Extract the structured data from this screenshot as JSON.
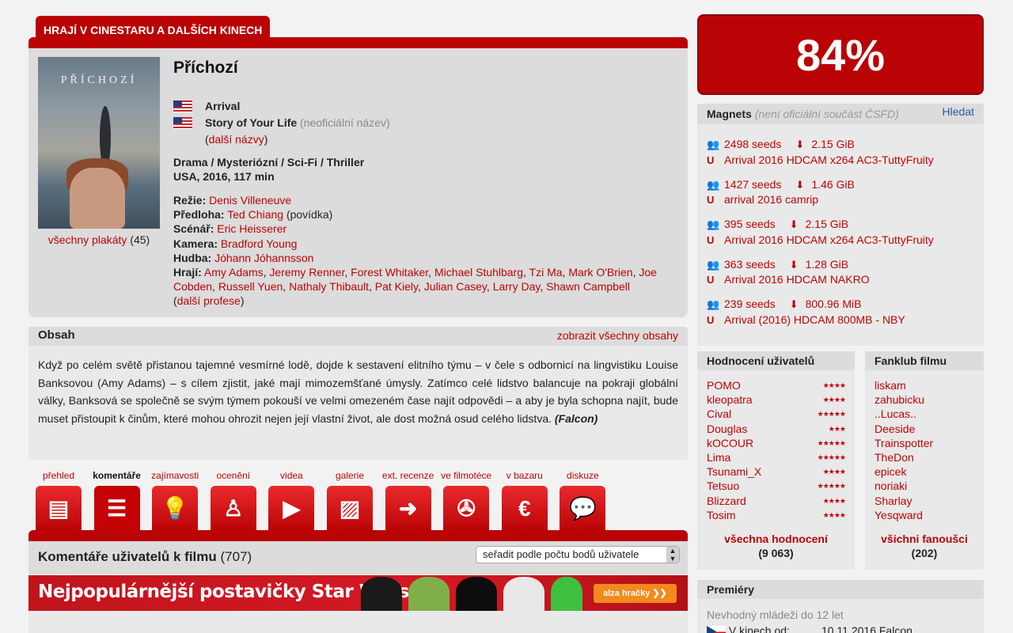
{
  "header_tab": "HRAJÍ V CINESTARU A DALŠÍCH KINECH",
  "film": {
    "poster_title": "PŘÍCHOZÍ",
    "all_posters_link": "všechny plakáty",
    "all_posters_count": "(45)",
    "title": "Příchozí",
    "names": [
      {
        "name": "Arrival",
        "note": ""
      },
      {
        "name": "Story of Your Life",
        "note": "(neoficiální název)"
      }
    ],
    "other_names_pre": "(",
    "other_names_link": "další názvy",
    "other_names_post": ")",
    "genre": "Drama / Mysteriózní / Sci-Fi / Thriller",
    "origin": "USA, 2016, 117 min",
    "creators": {
      "directing_label": "Režie:",
      "directing": "Denis Villeneuve",
      "source_label": "Předloha:",
      "source": "Ted Chiang",
      "source_note": "(povídka)",
      "script_label": "Scénář:",
      "script": "Eric Heisserer",
      "camera_label": "Kamera:",
      "camera": "Bradford Young",
      "music_label": "Hudba:",
      "music": "Jóhann Jóhannsson",
      "cast_label": "Hrají:",
      "cast": [
        "Amy Adams",
        "Jeremy Renner",
        "Forest Whitaker",
        "Michael Stuhlbarg",
        "Tzi Ma",
        "Mark O'Brien",
        "Joe Cobden",
        "Russell Yuen",
        "Nathaly Thibault",
        "Pat Kiely",
        "Julian Casey",
        "Larry Day",
        "Shawn Campbell"
      ],
      "more_professions": "další profese"
    }
  },
  "plot": {
    "heading": "Obsah",
    "show_all": "zobrazit všechny obsahy",
    "text": "Když po celém světě přistanou tajemné vesmírné lodě, dojde k sestavení elitního týmu – v čele s odbornicí na lingvistiku Louise Banksovou (Amy Adams) – s cílem zjistit, jaké mají mimozemšťané úmysly. Zatímco celé lidstvo balancuje na pokraji globální války, Banksová se společně se svým týmem pokouší ve velmi omezeném čase najít odpovědi – a aby je byla schopna najít, bude muset přistoupit k činům, které mohou ohrozit nejen její vlastní život, ale dost možná osud celého lidstva.",
    "author": "(Falcon)"
  },
  "tabs": [
    {
      "label": "přehled",
      "icon": "overview-icon",
      "glyph": "▤"
    },
    {
      "label": "komentáře",
      "icon": "comments-icon",
      "glyph": "☰"
    },
    {
      "label": "zajímavosti",
      "icon": "lightbulb-icon",
      "glyph": "💡"
    },
    {
      "label": "ocenění",
      "icon": "oscar-icon",
      "glyph": "♙"
    },
    {
      "label": "videa",
      "icon": "video-icon",
      "glyph": "▶"
    },
    {
      "label": "galerie",
      "icon": "gallery-icon",
      "glyph": "▨"
    },
    {
      "label": "ext. recenze",
      "icon": "external-review-icon",
      "glyph": "➜"
    },
    {
      "label": "ve filmotéce",
      "icon": "film-reel-icon",
      "glyph": "✇"
    },
    {
      "label": "v bazaru",
      "icon": "euro-icon",
      "glyph": "€"
    },
    {
      "label": "diskuze",
      "icon": "discussion-icon",
      "glyph": "💬"
    }
  ],
  "comments": {
    "heading": "Komentáře uživatelů k filmu",
    "count": "(707)",
    "sort_value": "seřadit podle počtu bodů uživatele"
  },
  "banner": {
    "text": "Nejpopulárnější postavičky Star Wars",
    "button": "alza hračky  ❯❯"
  },
  "rating": "84%",
  "magnets": {
    "heading": "Magnets",
    "note": "(není oficiální součást ČSFD)",
    "search": "Hledat",
    "items": [
      {
        "seeds": "2498 seeds",
        "size": "2.15 GiB",
        "name": "Arrival 2016 HDCAM x264 AC3-TuttyFruity"
      },
      {
        "seeds": "1427 seeds",
        "size": "1.46 GiB",
        "name": "arrival 2016 camrip"
      },
      {
        "seeds": "395 seeds",
        "size": "2.15 GiB",
        "name": "Arrival 2016 HDCAM x264 AC3-TuttyFruity"
      },
      {
        "seeds": "363 seeds",
        "size": "1.28 GiB",
        "name": "Arrival 2016 HDCAM NAKRO"
      },
      {
        "seeds": "239 seeds",
        "size": "800.96 MiB",
        "name": "Arrival (2016) HDCAM 800MB - NBY"
      }
    ]
  },
  "user_ratings": {
    "heading": "Hodnocení uživatelů",
    "items": [
      {
        "user": "POMO",
        "stars": 4
      },
      {
        "user": "kleopatra",
        "stars": 4
      },
      {
        "user": "Cival",
        "stars": 5
      },
      {
        "user": "Douglas",
        "stars": 3
      },
      {
        "user": "kOCOUR",
        "stars": 5
      },
      {
        "user": "Lima",
        "stars": 5
      },
      {
        "user": "Tsunami_X",
        "stars": 4
      },
      {
        "user": "Tetsuo",
        "stars": 5
      },
      {
        "user": "Blizzard",
        "stars": 4
      },
      {
        "user": "Tosim",
        "stars": 4
      }
    ],
    "all_link": "všechna hodnocení",
    "all_count": "(9 063)"
  },
  "fanclub": {
    "heading": "Fanklub filmu",
    "items": [
      "liskam",
      "zahubicku",
      "..Lucas..",
      "Deeside",
      "Trainspotter",
      "TheDon",
      "epicek",
      "noriaki",
      "Sharlay",
      "Yesqward"
    ],
    "all_link": "všichni fanoušci",
    "all_count": "(202)"
  },
  "premieres": {
    "heading": "Premiéry",
    "age_note": "Nevhodný mládeži do 12 let",
    "cinema_label": "V kinech od:",
    "cinema_date": "10.11.2016 Falcon"
  },
  "colors": {
    "accent": "#ba0305",
    "panel": "#dcdcdc",
    "panel_light": "#e9e9e9"
  }
}
